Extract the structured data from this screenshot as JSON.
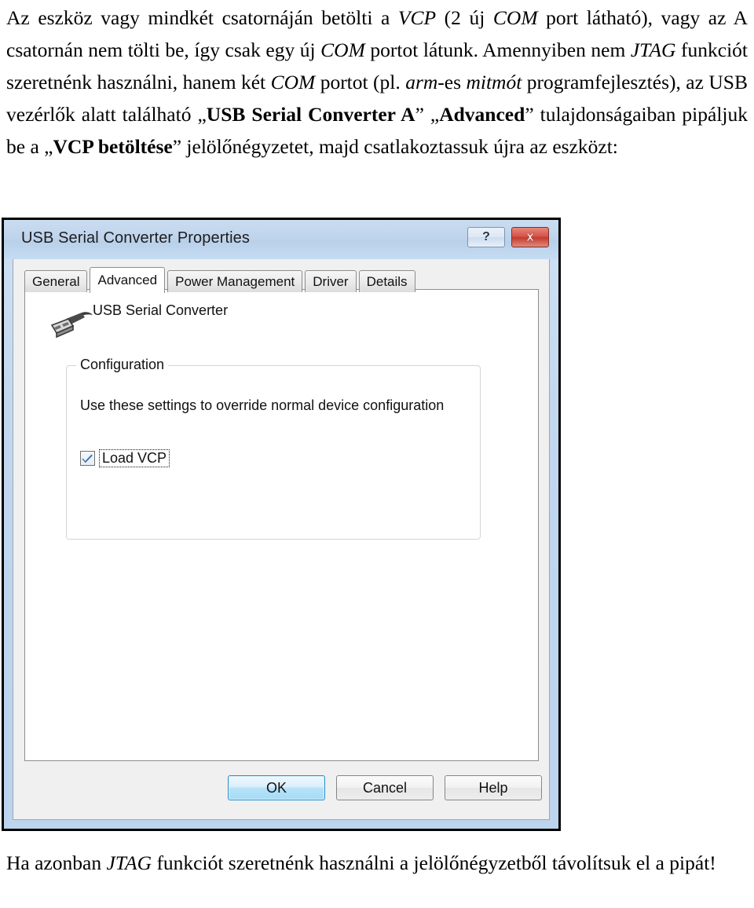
{
  "document": {
    "paragraph_top_html": "Az eszköz vagy mindkét csatornáján betölti a <i>VCP</i> (2 új <i>COM</i> port látható), vagy az A csatornán nem tölti be, így csak egy új <i>COM</i> portot látunk. Amennyiben nem <i>JTAG</i> funkciót szeretnénk használni, hanem két <i>COM</i> portot (pl. <i>arm</i>-es <i>mitmót</i> programfejlesztés), az USB vezérlők alatt található „<b>USB Serial Converter A</b>” „<b>Advanced</b>” tulajdonságaiban pipáljuk be a „<b>VCP betöltése</b>” jelölőnégyzetet, majd csatlakoztassuk újra az eszközt:",
    "paragraph_bottom_html": "Ha azonban <i>JTAG</i> funkciót szeretnénk használni a jelölőnégyzetből távolítsuk el a pipát!"
  },
  "dialog": {
    "title": "USB Serial Converter Properties",
    "caption_buttons": {
      "help": "?",
      "close": "close-icon"
    },
    "tabs": [
      {
        "label": "General",
        "active": false
      },
      {
        "label": "Advanced",
        "active": true
      },
      {
        "label": "Power Management",
        "active": false
      },
      {
        "label": "Driver",
        "active": false
      },
      {
        "label": "Details",
        "active": false
      }
    ],
    "device": {
      "icon": "usb-connector-icon",
      "name": "USB Serial Converter"
    },
    "configuration_group": {
      "legend": "Configuration",
      "description": "Use these settings to override normal device configuration",
      "checkbox": {
        "label": "Load VCP",
        "checked": true,
        "focused": true
      }
    },
    "buttons": {
      "ok": "OK",
      "cancel": "Cancel",
      "help": "Help"
    },
    "colors": {
      "titlebar": "#bfd4ec",
      "close_button": "#c43a2d",
      "default_button_accent": "#2c8fc9",
      "checkmark": "#3c6fb0",
      "dialog_background": "#f0f0f0",
      "panel_background": "#ffffff"
    }
  }
}
